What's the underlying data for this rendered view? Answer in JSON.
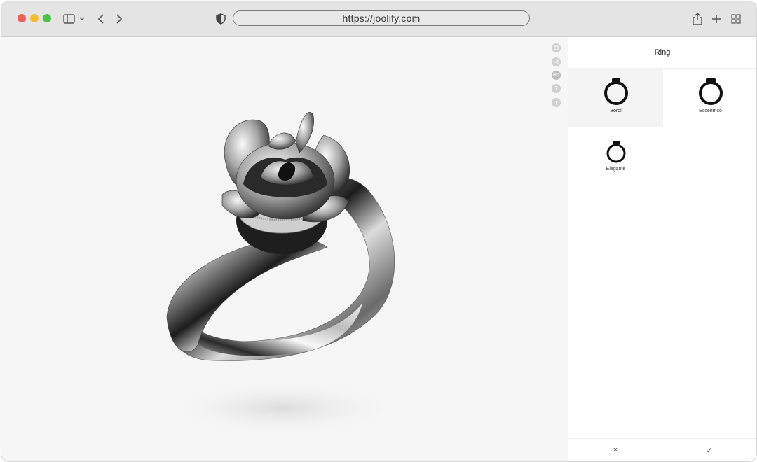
{
  "browser": {
    "url": "https://joolify.com",
    "icons": {
      "sidebar": "sidebar-icon",
      "back": "chevron-left-icon",
      "forward": "chevron-right-icon",
      "privacy": "shield-icon",
      "share": "share-icon",
      "new_tab": "plus-icon",
      "tabs": "tab-overview-icon"
    }
  },
  "viewer": {
    "tools": [
      "fullscreen-icon",
      "share-icon",
      "hd-icon",
      "help-icon",
      "view-icon"
    ],
    "hd_label": "HD",
    "help_label": "?"
  },
  "panel": {
    "title": "Ring",
    "options": [
      {
        "label": "Bordi",
        "selected": true
      },
      {
        "label": "Eccentrico",
        "selected": false
      },
      {
        "label": "Elegante",
        "selected": false
      }
    ],
    "cancel_label": "×",
    "confirm_label": "✓"
  },
  "colors": {
    "traffic_red": "#ee5f57",
    "traffic_yellow": "#f5bd2e",
    "traffic_green": "#43c83f",
    "selected_option_bg": "#f4f4f4"
  }
}
